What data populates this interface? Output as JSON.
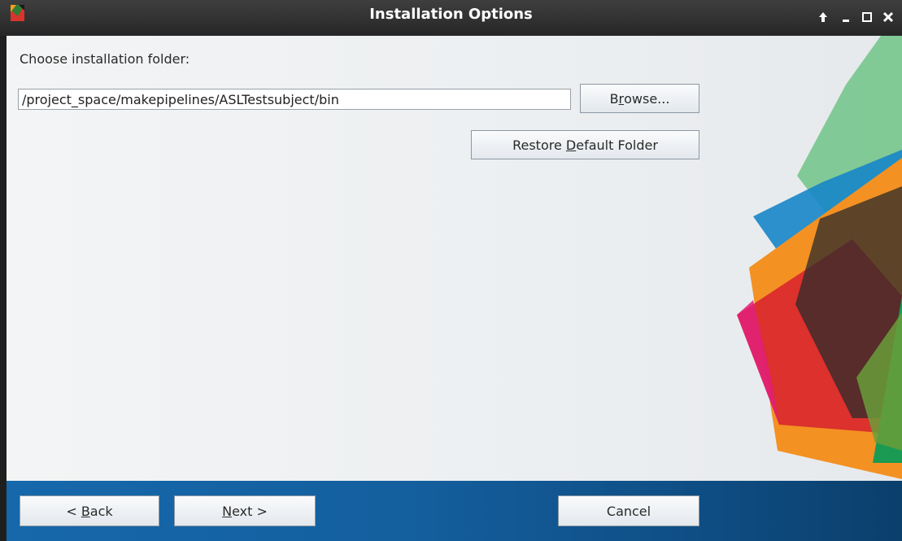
{
  "window": {
    "title": "Installation Options",
    "controls": [
      "pin-icon",
      "minimize-icon",
      "maximize-icon",
      "close-icon"
    ]
  },
  "main": {
    "choose_label": "Choose installation folder:",
    "folder_value": "/project_space/makepipelines/ASLTestsubject/bin",
    "browse": {
      "pre": "B",
      "mnemonic": "r",
      "post": "owse..."
    },
    "restore": {
      "pre": "Restore ",
      "mnemonic": "D",
      "post": "efault Folder"
    }
  },
  "footer": {
    "back": {
      "pre": "< ",
      "mnemonic": "B",
      "post": "ack"
    },
    "next": {
      "pre": "",
      "mnemonic": "N",
      "post": "ext >"
    },
    "cancel": "Cancel"
  },
  "colors": {
    "titlebar": "#2e2e2e",
    "content_bg": "#eef0f2",
    "footer_bar": "#145f9e",
    "button_border": "#8d98a3"
  }
}
